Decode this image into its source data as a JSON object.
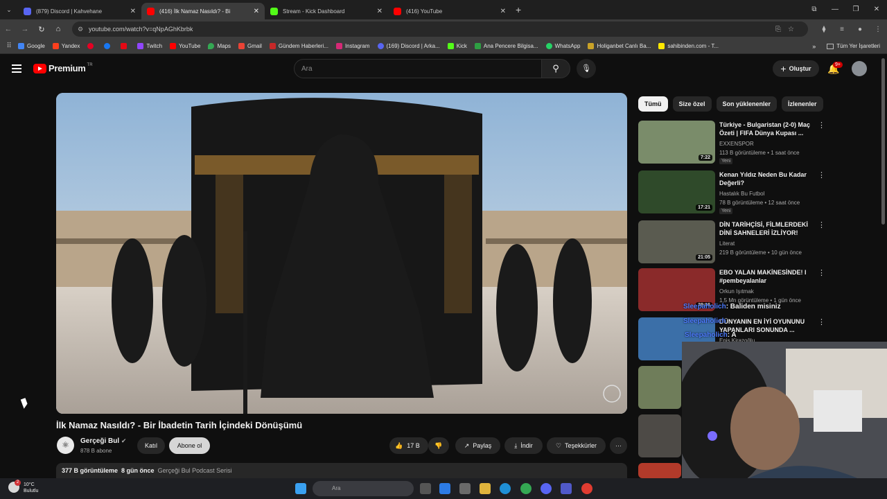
{
  "browser": {
    "tabs": [
      {
        "title": "(879) Discord | Kahvehane",
        "color": "#5865f2",
        "active": false
      },
      {
        "title": "(416) İlk Namaz Nasıldı? - Bi",
        "color": "#ff0000",
        "active": true
      },
      {
        "title": "Stream - Kick Dashboard",
        "color": "#53fc18",
        "active": false
      },
      {
        "title": "(416) YouTube",
        "color": "#ff0000",
        "active": false
      }
    ],
    "url": "youtube.com/watch?v=qNpAGhKbrbk",
    "bookmarks": [
      "Google",
      "Yandex",
      "",
      "",
      "",
      "Twitch",
      "YouTube",
      "Maps",
      "Gmail",
      "Gündem Haberleri...",
      "Instagram",
      "(169) Discord | Arka...",
      "Kick",
      "Ana Pencere Bilgisa...",
      "WhatsApp",
      "Holiganbet Canlı Ba...",
      "sahibinden.com - T..."
    ],
    "bookmarks_all": "Tüm Yer İşaretleri"
  },
  "youtube": {
    "logo": "Premium",
    "region": "TR",
    "search_placeholder": "Ara",
    "create_label": "Oluştur",
    "notifications": "9+"
  },
  "video": {
    "title": "İlk Namaz Nasıldı? - Bir İbadetin Tarih İçindeki Dönüşümü",
    "channel": "Gerçeği Bul",
    "subscribers": "878 B abone",
    "join_label": "Katıl",
    "subscribe_label": "Abone ol",
    "likes": "17 B",
    "share_label": "Paylaş",
    "download_label": "İndir",
    "thanks_label": "Teşekkürler",
    "more_label": "···",
    "views": "377 B görüntüleme",
    "age": "8 gün önce",
    "series": "Gerçeği Bul Podcast Serisi"
  },
  "chips": [
    "Tümü",
    "Size özel",
    "Son yüklenenler",
    "İzlenenler"
  ],
  "recommendations": [
    {
      "title": "Türkiye - Bulgaristan (2-0) Maç Özeti | FIFA Dünya Kupası ...",
      "channel": "EXXENSPOR",
      "meta": "113 B görüntüleme • 1 saat önce",
      "badge": "Yeni",
      "duration": "7:22",
      "thumb": "#7a8c6a"
    },
    {
      "title": "Kenan Yıldız Neden Bu Kadar Değerli?",
      "channel": "Hastalık Bu Futbol",
      "meta": "78 B görüntüleme • 12 saat önce",
      "badge": "Yeni",
      "duration": "17:21",
      "thumb": "#2f4a2a"
    },
    {
      "title": "DİN TARİHÇİSİ, FİLMLERDEKİ DİNİ SAHNELERİ İZLİYOR!",
      "channel": "Literat",
      "meta": "219 B görüntüleme • 10 gün önce",
      "badge": "",
      "duration": "21:05",
      "thumb": "#5a5b50"
    },
    {
      "title": "EBO YALAN MAKİNESİNDE! I #pembeyalanlar",
      "channel": "Orkun Işıtmak",
      "meta": "1,5 Mn görüntüleme • 1 gün önce",
      "badge": "",
      "duration": "39:06",
      "thumb": "#8a2a2a"
    },
    {
      "title": "DÜNYANIN EN İYİ OYUNUNU YAPANLARI SONUNDA ...",
      "channel": "Enis Kirazoğlu",
      "meta": "",
      "badge": "",
      "duration": "",
      "thumb": "#3b6fa8"
    }
  ],
  "chat": [
    {
      "user": "Sleepaholich",
      "message": ": Baliden misiniz"
    },
    {
      "user": "Sleepaholich",
      "message": ""
    },
    {
      "user": "Sleepaholich",
      "message": ": A"
    }
  ],
  "taskbar": {
    "temp": "10°C",
    "weather": "Bulutlu",
    "weather_badge": "2",
    "search": "Ara"
  }
}
